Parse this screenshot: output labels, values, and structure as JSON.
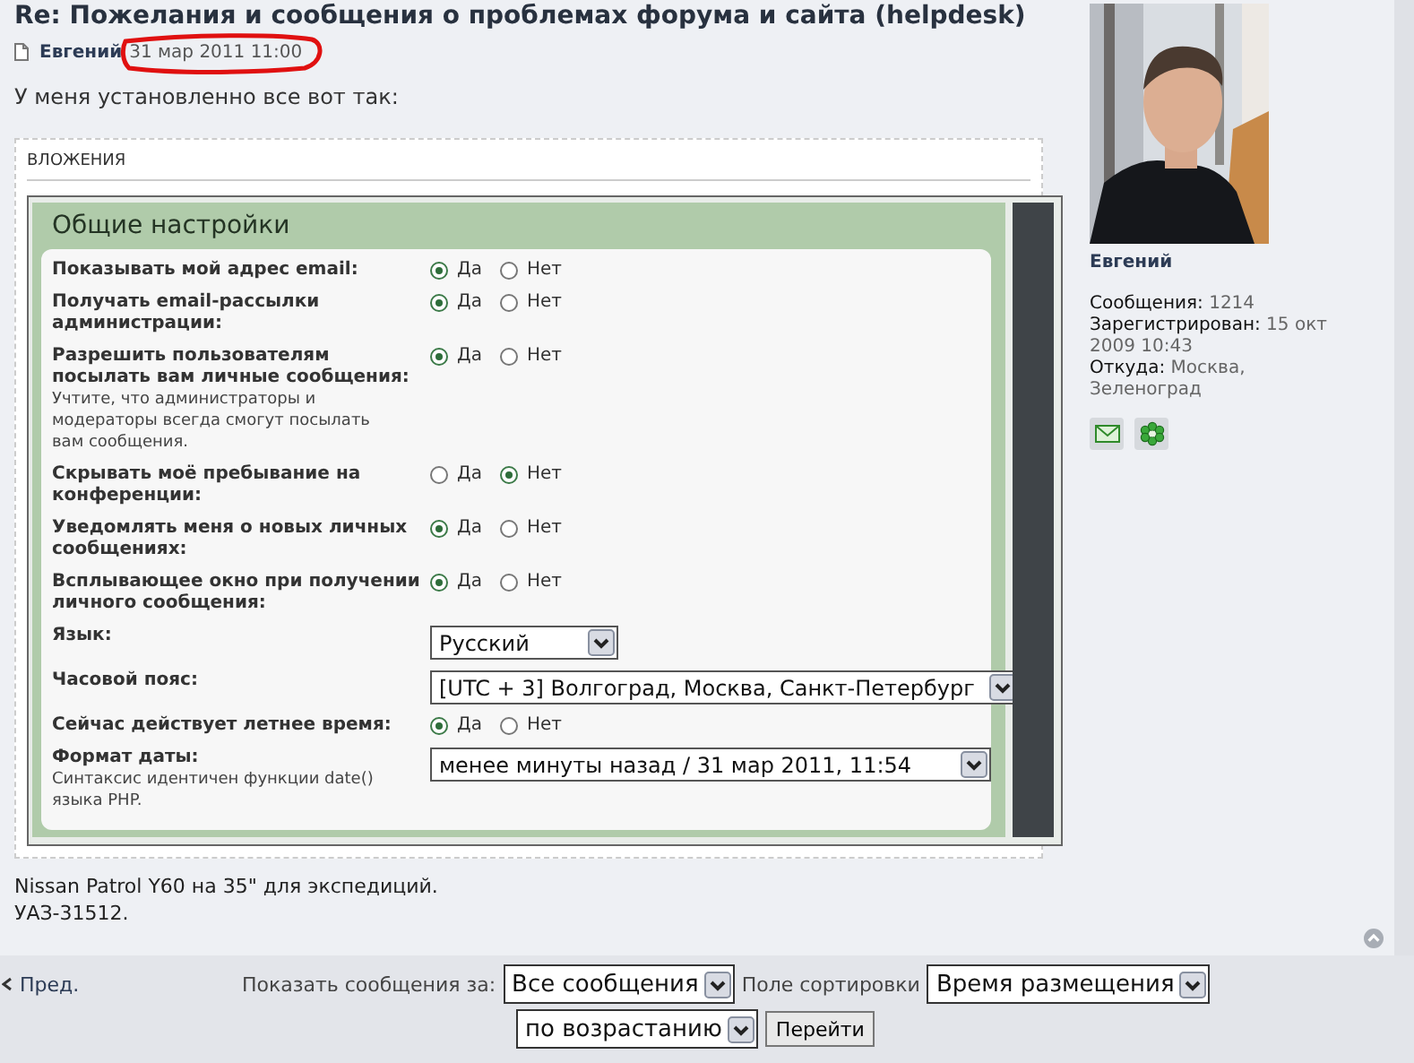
{
  "post": {
    "title": "Re: Пожелания и сообщения о проблемах форума и сайта (helpdesk)",
    "author": "Евгений",
    "date": "31 мар 2011 11:00",
    "body": "У меня установленно все вот так:"
  },
  "attachment": {
    "heading": "ВЛОЖЕНИЯ",
    "panel_title": "Общие настройки",
    "settings": [
      {
        "kind": "radio",
        "label": "Показывать мой адрес email:",
        "options": [
          {
            "label": "Да",
            "selected": true
          },
          {
            "label": "Нет",
            "selected": false
          }
        ]
      },
      {
        "kind": "radio",
        "label": "Получать email-рассылки администрации:",
        "options": [
          {
            "label": "Да",
            "selected": true
          },
          {
            "label": "Нет",
            "selected": false
          }
        ]
      },
      {
        "kind": "radio",
        "label": "Разрешить пользователям посылать вам личные сообщения:",
        "hint": "Учтите, что администраторы и модераторы всегда смогут посылать вам сообщения.",
        "options": [
          {
            "label": "Да",
            "selected": true
          },
          {
            "label": "Нет",
            "selected": false
          }
        ]
      },
      {
        "kind": "radio",
        "label": "Скрывать моё пребывание на конференции:",
        "options": [
          {
            "label": "Да",
            "selected": false
          },
          {
            "label": "Нет",
            "selected": true
          }
        ]
      },
      {
        "kind": "radio",
        "label": "Уведомлять меня о новых личных сообщениях:",
        "options": [
          {
            "label": "Да",
            "selected": true
          },
          {
            "label": "Нет",
            "selected": false
          }
        ]
      },
      {
        "kind": "radio",
        "label": "Всплывающее окно при получении личного сообщения:",
        "options": [
          {
            "label": "Да",
            "selected": true
          },
          {
            "label": "Нет",
            "selected": false
          }
        ]
      },
      {
        "kind": "select",
        "label": "Язык:",
        "value": "Русский"
      },
      {
        "kind": "select",
        "label": "Часовой пояс:",
        "value": "[UTC + 3] Волгоград, Москва, Санкт-Петербург"
      },
      {
        "kind": "radio",
        "label": "Сейчас действует летнее время:",
        "options": [
          {
            "label": "Да",
            "selected": true
          },
          {
            "label": "Нет",
            "selected": false
          }
        ]
      },
      {
        "kind": "select",
        "label": "Формат даты:",
        "hint": "Синтаксис идентичен функции date() языка PHP.",
        "value": "менее минуты назад / 31 мар 2011, 11:54"
      }
    ]
  },
  "signature": [
    "Nissan Patrol Y60 на 35\" для экспедиций.",
    "УАЗ-31512."
  ],
  "profile": {
    "name": "Евгений",
    "stats": [
      {
        "label": "Сообщения:",
        "value": "1214"
      },
      {
        "label": "Зарегистрирован:",
        "value": "15 окт 2009 10:43"
      },
      {
        "label": "Откуда:",
        "value": "Москва, Зеленоград"
      }
    ]
  },
  "footer": {
    "prev": "Пред.",
    "show_label": "Показать сообщения за:",
    "show_value": "Все сообщения",
    "sort_label": "Поле сортировки",
    "sort_value": "Время размещения",
    "order_value": "по возрастанию",
    "go_button": "Перейти"
  }
}
